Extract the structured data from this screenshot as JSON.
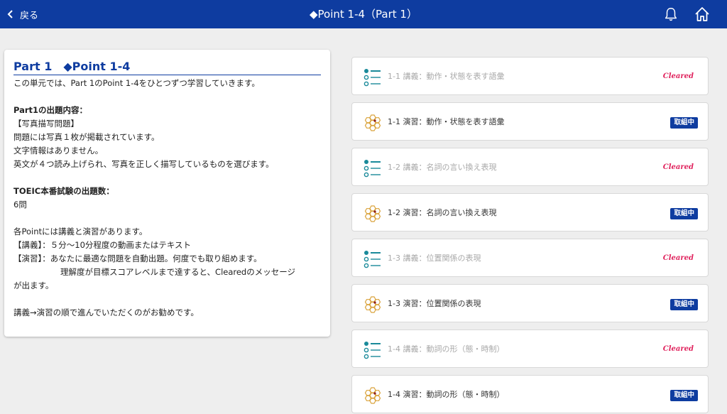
{
  "header": {
    "back_label": "戻る",
    "title": "◆Point 1-4（Part 1）"
  },
  "intro": {
    "title": "Part 1　◆Point 1-4",
    "lines": [
      "この単元では、Part 1のPoint 1-4をひとつずつ学習していきます。",
      "",
      "Part1の出題内容：",
      "【写真描写問題】",
      "問題には写真１枚が掲載されています。",
      "文字情報はありません。",
      "英文が４つ読み上げられ、写真を正しく描写しているものを選びます。",
      "",
      "TOEIC本番試験の出題数：",
      "6問",
      "",
      "各Pointには講義と演習があります。",
      "【講義】：５分～10分程度の動画またはテキスト",
      "【演習】：あなたに最適な問題を自動出題。何度でも取り組めます。",
      "理解度が目標スコアレベルまで達すると、Clearedのメッセージ",
      "が出ます。",
      "",
      "講義→演習の順で進んでいただくのがお勧めです。"
    ]
  },
  "units": [
    {
      "label": "1-1 講義：動作・状態を表す語彙",
      "type": "lecture",
      "status": "Cleared"
    },
    {
      "label": "1-1 演習：動作・状態を表す語彙",
      "type": "practice",
      "status": "取組中"
    },
    {
      "label": "1-2 講義：名詞の言い換え表現",
      "type": "lecture",
      "status": "Cleared"
    },
    {
      "label": "1-2 演習：名詞の言い換え表現",
      "type": "practice",
      "status": "取組中"
    },
    {
      "label": "1-3 講義：位置関係の表現",
      "type": "lecture",
      "status": "Cleared"
    },
    {
      "label": "1-3 演習：位置関係の表現",
      "type": "practice",
      "status": "取組中"
    },
    {
      "label": "1-4 講義：動詞の形（態・時制）",
      "type": "lecture",
      "status": "Cleared"
    },
    {
      "label": "1-4 演習：動詞の形（態・時制）",
      "type": "practice",
      "status": "取組中"
    }
  ],
  "colors": {
    "brand": "#0e3ca0",
    "cleared": "#e0245e",
    "lecture_icon": "#1a8a9a",
    "practice_icon": "#d9a23a"
  },
  "icons": {
    "back": "chevron-left-icon",
    "notifications": "bell-icon",
    "home": "home-icon",
    "lecture": "list-icon",
    "practice": "honeycomb-icon"
  }
}
